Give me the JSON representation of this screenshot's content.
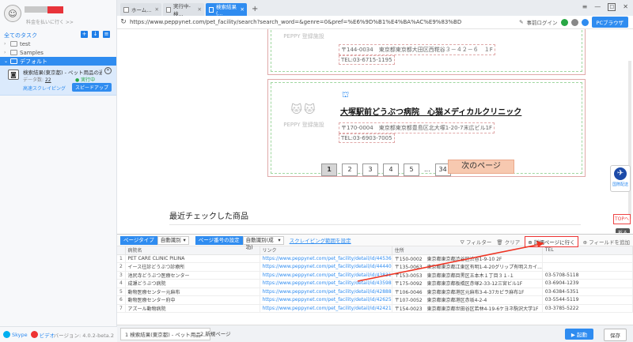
{
  "sidebar": {
    "upgrade": "料金を払いに行く >>",
    "all_tasks": "全てのタスク",
    "tree": [
      {
        "label": "test"
      },
      {
        "label": "Samples"
      },
      {
        "label": "デフォルト"
      }
    ],
    "task": {
      "title": "検索結果(東京都) - ペット用品の通販サイ...",
      "data_label": "データ数:",
      "data_count": "22",
      "status": "● 実行中",
      "mode": "高速スクレイピング",
      "speed_button": "スピードアップ"
    },
    "footer": {
      "skype": "Skype",
      "video": "ビデオ",
      "version": "バージョン: 4.0.2-beta.2"
    }
  },
  "browser": {
    "tabs": [
      {
        "label": "ホーム..."
      },
      {
        "label": "実行中-検..."
      },
      {
        "label": "検索結果(..."
      }
    ],
    "url": "https://www.peppynet.com/pet_facility/search?search_word=&genre=0&pref=%E6%9D%B1%E4%BA%AC%E9%83%BD",
    "login": "事前ログイン",
    "pc_browser": "PCブラウザ"
  },
  "page": {
    "card1": {
      "address": "〒144-0034　東京都東京都大田区西糀谷３－４２－６　１F",
      "tel": "TEL:03-6715-1195"
    },
    "card2": {
      "brand": "PEPPY 登録施設",
      "name": "大塚駅前どうぶつ病院　心猫メディカルクリニック",
      "address": "〒170-0004　東京都東京都豊島区北大塚1-20-7末広ビル1F",
      "tel": "TEL:03-6903-7005"
    },
    "pager": [
      "1",
      "2",
      "3",
      "4",
      "5",
      "...",
      "34"
    ],
    "next": "次のページ",
    "recent": "最近チェックした商品",
    "float_globe": "国際配送",
    "float_top": "TOPへ",
    "collapse": "折る"
  },
  "panel": {
    "page_type_label": "ページタイプ",
    "page_type_value": "自動識別",
    "page_num_label": "ページ番号の設定",
    "page_num_value": "自動識別(成功)",
    "scrape_range": "スクレイピング範囲を設定",
    "filter": "フィルター",
    "clear": "クリア",
    "detail": "詳細ページに行く",
    "add_field": "フィールドを追加",
    "columns": [
      "",
      "病院名",
      "リンク",
      "住所",
      "TEL"
    ],
    "rows": [
      [
        "1",
        "PET CARE CLINIC PILINA",
        "https://www.peppynet.com/pet_facility/detail/id/44536",
        "〒150-0002　東京都東京都渋谷区渋谷1-9-10 2F",
        ""
      ],
      [
        "2",
        "イース往診どうぶつ診療所",
        "https://www.peppynet.com/pet_facility/detail/id/44440",
        "〒135-0063　東京都東京都江東区有明1-4-20グリップ有明スカイ...",
        ""
      ],
      [
        "3",
        "池尻寺どうぶつ医療センター",
        "https://www.peppynet.com/pet_facility/detail/id/43831",
        "〒153-0053　東京都東京都目黒区五本木１丁目３１-１",
        "03-5708-5118"
      ],
      [
        "4",
        "成瀬どうぶつ病院",
        "https://www.peppynet.com/pet_facility/detail/id/43598",
        "〒175-0092　東京都東京都板橋区赤塚2-33-12三宮ビル1F",
        "03-6904-1239"
      ],
      [
        "5",
        "動物医療センター元麻布",
        "https://www.peppynet.com/pet_facility/detail/id/42888",
        "〒106-0046　東京都東京都港区元麻布3-4-37カピラ麻布1F",
        "03-6384-5351"
      ],
      [
        "6",
        "動物医療センター府中",
        "https://www.peppynet.com/pet_facility/detail/id/42625",
        "〒107-0052　東京都東京都港区赤坂4-2-4",
        "03-5544-5119"
      ],
      [
        "7",
        "アズール動物病院",
        "https://www.peppynet.com/pet_facility/detail/id/42421",
        "〒154-0023　東京都東京都世田谷区若林4-19-6ケヨネ駒沢大学1F",
        "03-3785-5222"
      ]
    ]
  },
  "bottom": {
    "tabs": [
      {
        "label": "1  検索結果(東京都) - ペット用品..."
      },
      {
        "label": "2  新規ページ"
      }
    ],
    "run": "▶ 起動",
    "save": "保存"
  }
}
